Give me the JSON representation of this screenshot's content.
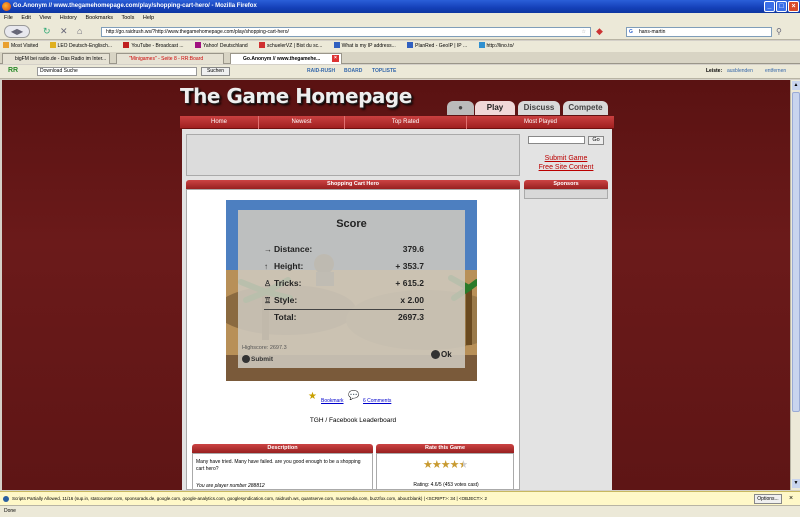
{
  "browser": {
    "title": "Go.Anonym // www.thegamehomepage.com/play/shopping-cart-hero/ - Mozilla Firefox",
    "menu": [
      "File",
      "Edit",
      "View",
      "History",
      "Bookmarks",
      "Tools",
      "Help"
    ],
    "url": "http://go.raidrush.ws/?http://www.thegamehomepage.com/play/shopping-cart-hero/",
    "search_value": "hans-martin",
    "bookmarks": [
      "Most Visited",
      "LEO Deutsch-Englisch...",
      "YouTube - Broadcast ...",
      "Yahoo! Deutschland",
      "schuelerVZ | Bist du sc...",
      "What is my IP address...",
      "PlanRed - GeoIP | IP ...",
      "http://lino.to/"
    ],
    "tabs": [
      "bigFM bei radio.de - Das Radio im Inter...",
      "\"Minigames\" - Seite 8 - RR:Board",
      "Go.Anonym // www.thegamehe..."
    ],
    "status_text": "Done",
    "noscript_text": "Scripts Partially Allowed, 11/16 (sup.in, statcounter.com, sponsorads.de, google.com, google-analytics.com, googlesyndication.com, raidrush.ws, quantserve.com, nuvomedia.com, buzzfox.com, about:blank) | <SCRIPT>: 34 | <OBJECT>: 2",
    "options_label": "Options..."
  },
  "addon": {
    "logo": "RR",
    "search_value": "Download Suche",
    "search_button": "Suchen",
    "links": [
      "RAID-RUSH",
      "BOARD",
      "TOPLISTE"
    ],
    "right_prefix": "Leiste:",
    "right_links": [
      "ausblenden",
      "entfernen"
    ]
  },
  "site": {
    "logo": "The Game Homepage",
    "tabs": [
      "Play",
      "Discuss",
      "Compete"
    ],
    "nav": [
      "Home",
      "Newest",
      "Top Rated",
      "Most Played"
    ],
    "search_button": "Go",
    "sidebar_links": [
      "Submit Game",
      "Free Site Content"
    ],
    "sponsors_label": "Sponsors"
  },
  "game": {
    "title": "Shopping Cart Hero",
    "score_title": "Score",
    "rows": [
      {
        "icon": "arrow-right-icon",
        "label": "Distance:",
        "value": "379.6"
      },
      {
        "icon": "arrow-up-icon",
        "label": "Height:",
        "value": "+ 353.7"
      },
      {
        "icon": "trick-icon",
        "label": "Tricks:",
        "value": "+ 615.2"
      },
      {
        "icon": "style-icon",
        "label": "Style:",
        "value": "x 2.00"
      }
    ],
    "total_label": "Total:",
    "total_value": "2697.3",
    "highscore": "Highscore: 2697.3",
    "submit_label": "Submit",
    "ok_label": "Ok",
    "bookmark_label": "Bookmark",
    "comments_label": "6 Comments",
    "leaderboard_label": "TGH / Facebook Leaderboard"
  },
  "description": {
    "header": "Description",
    "text": "Many have tried. Many have failed. are you good enough to be a shopping cart hero?",
    "player_number": "You are player number 288812"
  },
  "rating": {
    "header": "Rate this Game",
    "stars": 4.5,
    "text": "Rating: 4.6/5 (453 votes cast)"
  }
}
